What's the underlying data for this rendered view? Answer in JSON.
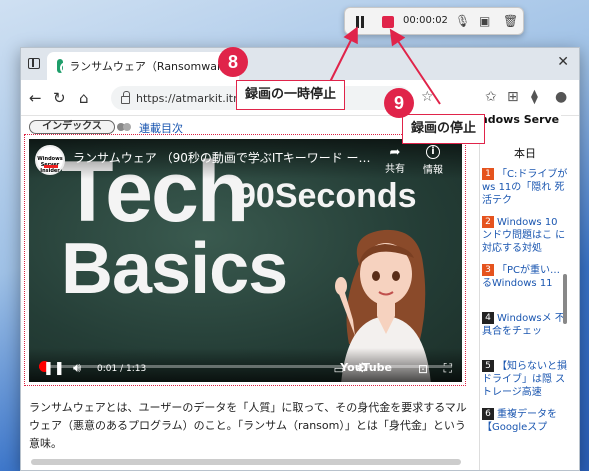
{
  "recording_bar": {
    "time": "00:00:02",
    "icons": [
      "pause-icon",
      "stop-icon",
      "mic-off-icon",
      "screen-share-icon",
      "trash-icon"
    ]
  },
  "browser": {
    "tab_title": "ランサムウェア（Ransomware）",
    "url": "https://atmarkit.itmed",
    "page": {
      "index_pill": "インデックス",
      "toc_link": "連載目次",
      "video": {
        "title": "ランサムウェア （90秒の動画で学ぶITキーワード ー…",
        "channel_logo_text": "Windows Server Insider",
        "share_label": "共有",
        "info_label": "情報",
        "big_text_line1": "Tech",
        "big_text_line2": "Basics",
        "big_text_90": "90Seconds",
        "time": "0:01 / 1:13",
        "progress": 0.013,
        "youtube_label": "YouTube"
      },
      "article_text": "ランサムウェアとは、ユーザーのデータを「人質」に取って、その身代金を要求するマルウェア（悪意のあるプログラム）のこと。「ランサム（ransom）」とは「身代金」という意味。"
    },
    "sidebar": {
      "banner": "Windows Serve",
      "heading": "本日",
      "items": [
        {
          "num": "1",
          "color": "#e5531e",
          "text": "「C:ドライブが ws 11の「隠れ 死活テク"
        },
        {
          "num": "2",
          "color": "#e5531e",
          "text": "Windows 10 ンドウ問題はこ に対応する対処"
        },
        {
          "num": "3",
          "color": "#e5531e",
          "text": "「PCが重い… るWindows 11"
        },
        {
          "num": "4",
          "color": "#222222",
          "text": "Windowsメ 不具合をチェッ"
        },
        {
          "num": "5",
          "color": "#222222",
          "text": "【知らないと損 ドライブ」は隠 ストレージ高速"
        },
        {
          "num": "6",
          "color": "#222222",
          "text": "重複データを 【Googleスプ"
        }
      ]
    }
  },
  "callouts": [
    {
      "num": "8",
      "label": "録画の一時停止"
    },
    {
      "num": "9",
      "label": "録画の停止"
    }
  ]
}
